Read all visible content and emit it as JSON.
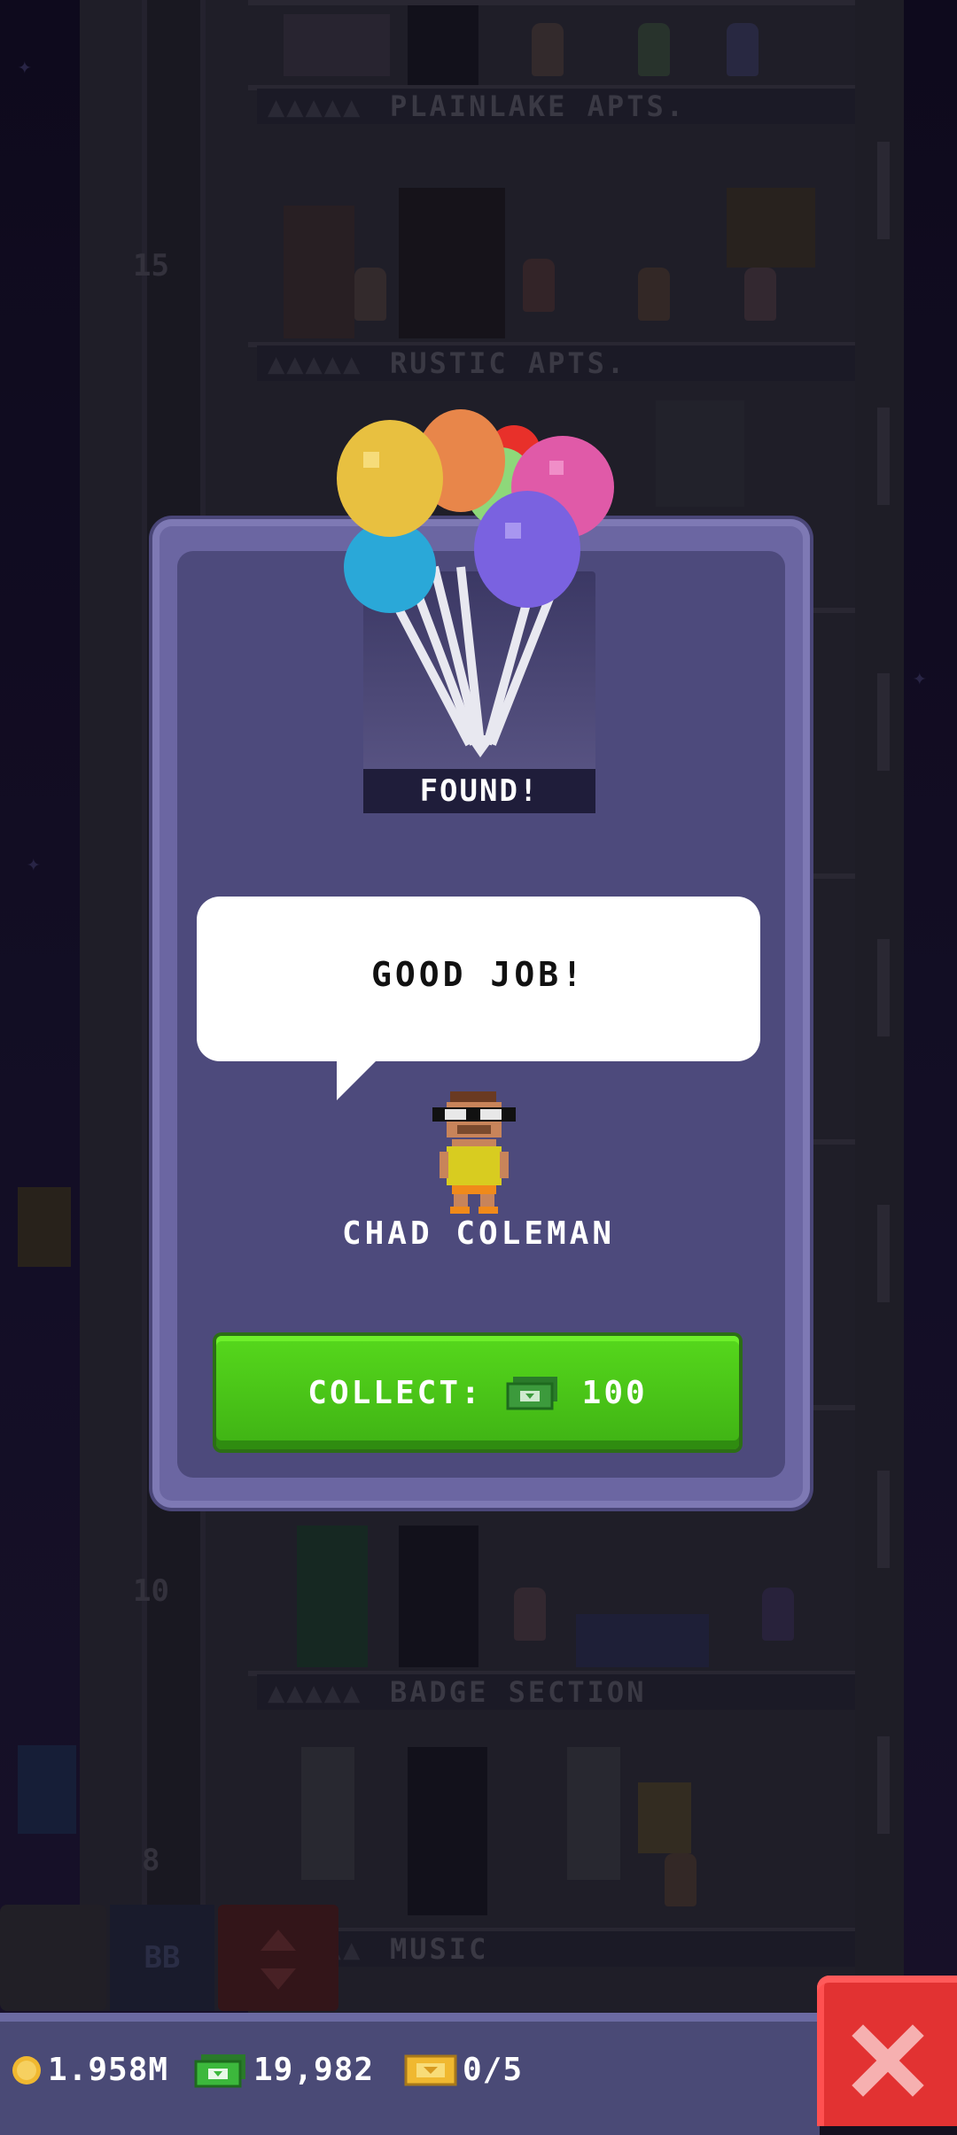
{
  "background": {
    "floor_signs": [
      "PLAINLAKE APTS.",
      "RUSTIC APTS.",
      "BADGE SECTION",
      "MUSIC"
    ],
    "floor_numbers": [
      "15",
      "10",
      "8"
    ],
    "toolbar_bb_label": "BB"
  },
  "modal": {
    "found_label": "FOUND!",
    "speech": "GOOD JOB!",
    "character_name": "CHAD COLEMAN",
    "collect_label": "COLLECT:",
    "collect_amount": "100"
  },
  "status": {
    "coins": "1.958M",
    "bux": "19,982",
    "tickets": "0/5"
  },
  "icons": {
    "coin": "coin-icon",
    "bux": "cash-icon",
    "ticket": "ticket-icon",
    "close": "close-icon",
    "elevator": "elevator-icon"
  },
  "colors": {
    "collect_green": "#4cc81a",
    "close_red": "#e23232",
    "modal_purple": "#4d4a7c"
  }
}
